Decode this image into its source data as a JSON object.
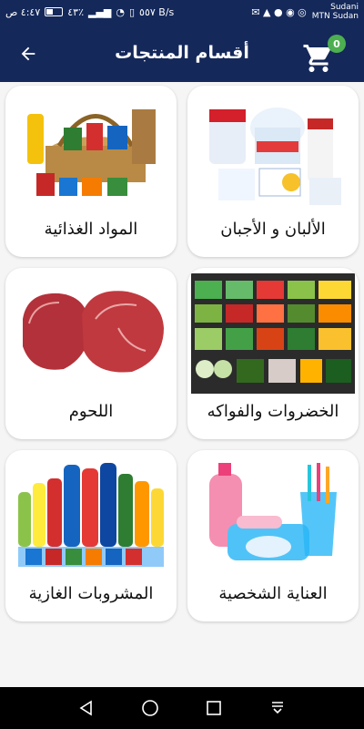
{
  "status_bar": {
    "time": "٤:٤٧ ص",
    "battery": "٤٣٪",
    "speed": "٥٥٧ B/s",
    "carrier_line1": "Sudani",
    "carrier_line2": "MTN Sudan"
  },
  "header": {
    "title": "أقسام المنتجات",
    "cart_count": "0",
    "brand_color": "#14285a",
    "badge_color": "#4caf50"
  },
  "categories": [
    {
      "label": "الألبان و الأجبان",
      "icon": "dairy-products-image"
    },
    {
      "label": "المواد الغذائية",
      "icon": "food-basket-image"
    },
    {
      "label": "الخضروات والفواكه",
      "icon": "vegetables-fruits-image"
    },
    {
      "label": "اللحوم",
      "icon": "meat-image"
    },
    {
      "label": "العناية الشخصية",
      "icon": "personal-care-image"
    },
    {
      "label": "المشروبات الغازية",
      "icon": "soft-drinks-image"
    }
  ]
}
